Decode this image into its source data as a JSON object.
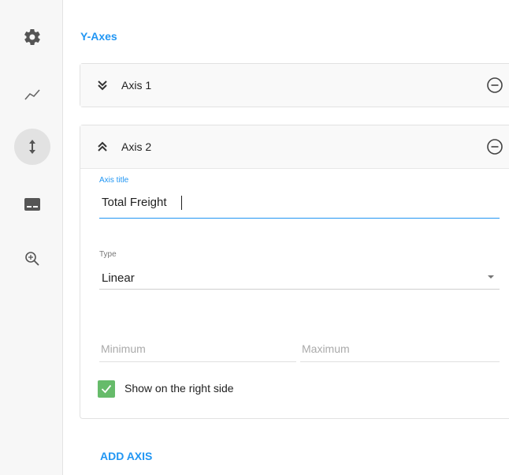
{
  "sidebar": {
    "items": [
      {
        "icon": "gear-icon",
        "active": false
      },
      {
        "icon": "line-chart-icon",
        "active": false
      },
      {
        "icon": "vertical-arrows-icon",
        "active": true
      },
      {
        "icon": "legend-icon",
        "active": false
      },
      {
        "icon": "zoom-in-icon",
        "active": false
      }
    ]
  },
  "section_title": "Y-Axes",
  "axes": [
    {
      "label": "Axis 1",
      "expanded": false
    },
    {
      "label": "Axis 2",
      "expanded": true
    }
  ],
  "axis2_form": {
    "title_label": "Axis title",
    "title_value": "Total Freight",
    "type_label": "Type",
    "type_value": "Linear",
    "min_placeholder": "Minimum",
    "max_placeholder": "Maximum",
    "right_side_label": "Show on the right side",
    "right_side_checked": true
  },
  "add_axis_label": "ADD AXIS",
  "colors": {
    "accent": "#2196f3",
    "checkbox": "#66bb6a",
    "sidebar_bg": "#f7f7f7"
  }
}
